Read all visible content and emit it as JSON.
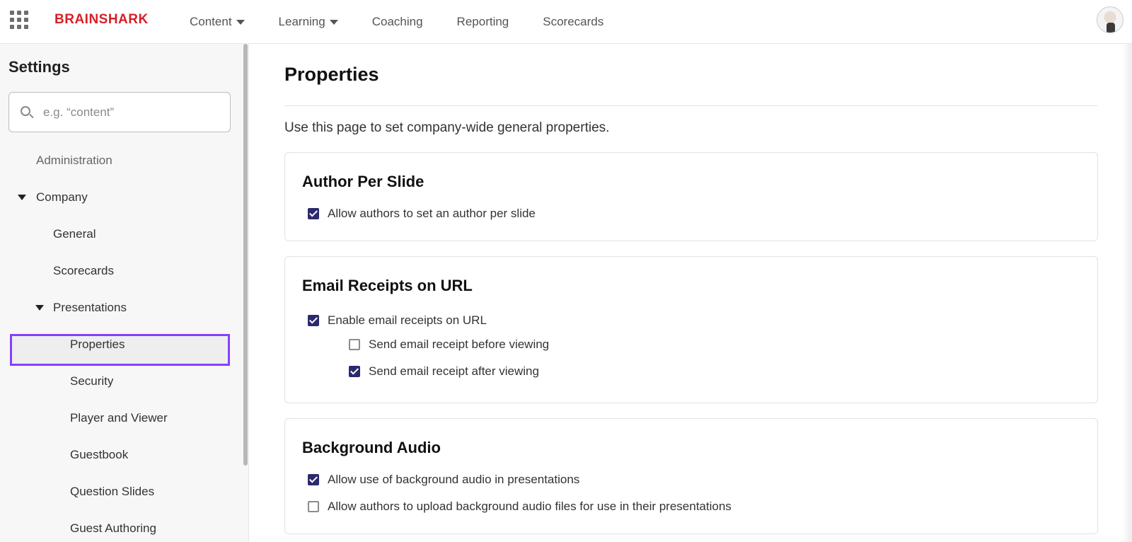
{
  "header": {
    "logo": "BRAINSHARK",
    "nav": [
      {
        "label": "Content",
        "dropdown": true
      },
      {
        "label": "Learning",
        "dropdown": true
      },
      {
        "label": "Coaching",
        "dropdown": false
      },
      {
        "label": "Reporting",
        "dropdown": false
      },
      {
        "label": "Scorecards",
        "dropdown": false
      }
    ]
  },
  "sidebar": {
    "title": "Settings",
    "search_placeholder": "e.g. “content”",
    "items": [
      {
        "label": "Administration",
        "level": 0,
        "expanded": null
      },
      {
        "label": "Company",
        "level": 0,
        "expanded": true
      },
      {
        "label": "General",
        "level": 1,
        "expanded": null
      },
      {
        "label": "Scorecards",
        "level": 1,
        "expanded": null
      },
      {
        "label": "Presentations",
        "level": 1,
        "expanded": true
      },
      {
        "label": "Properties",
        "level": 2,
        "selected": true
      },
      {
        "label": "Security",
        "level": 2
      },
      {
        "label": "Player and Viewer",
        "level": 2
      },
      {
        "label": "Guestbook",
        "level": 2
      },
      {
        "label": "Question Slides",
        "level": 2
      },
      {
        "label": "Guest Authoring",
        "level": 2
      }
    ]
  },
  "main": {
    "title": "Properties",
    "description": "Use this page to set company-wide general properties.",
    "sections": [
      {
        "title": "Author Per Slide",
        "options": [
          {
            "label": "Allow authors to set an author per slide",
            "checked": true,
            "indent": 0
          }
        ]
      },
      {
        "title": "Email Receipts on URL",
        "options": [
          {
            "label": "Enable email receipts on URL",
            "checked": true,
            "indent": 0
          },
          {
            "label": "Send email receipt before viewing",
            "checked": false,
            "indent": 1
          },
          {
            "label": "Send email receipt after viewing",
            "checked": true,
            "indent": 1
          }
        ]
      },
      {
        "title": "Background Audio",
        "options": [
          {
            "label": "Allow use of background audio in presentations",
            "checked": true,
            "indent": 0
          },
          {
            "label": "Allow authors to upload background audio files for use in their presentations",
            "checked": false,
            "indent": 0
          }
        ]
      }
    ]
  },
  "colors": {
    "brand": "#d81f26",
    "checkbox_checked": "#2b2a6e",
    "selection_outline": "#8a3ffc"
  }
}
